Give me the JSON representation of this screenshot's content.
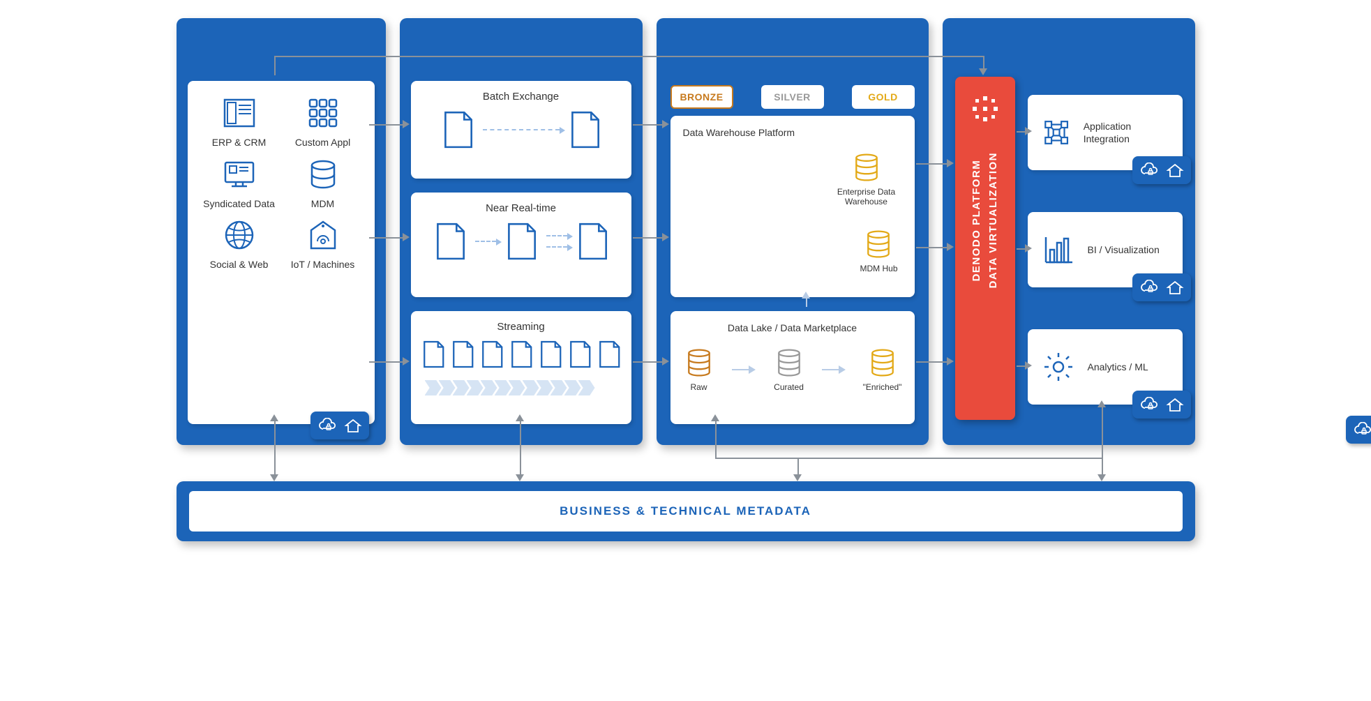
{
  "sources": {
    "items": [
      {
        "label": "ERP & CRM",
        "icon": "erp"
      },
      {
        "label": "Custom Appl",
        "icon": "grid"
      },
      {
        "label": "Syndicated Data",
        "icon": "monitor"
      },
      {
        "label": "MDM",
        "icon": "db"
      },
      {
        "label": "Social & Web",
        "icon": "globe"
      },
      {
        "label": "IoT / Machines",
        "icon": "iot"
      }
    ]
  },
  "processing": {
    "batch": "Batch Exchange",
    "nrt": "Near Real-time",
    "stream": "Streaming"
  },
  "tiers": {
    "bronze": "BRONZE",
    "silver": "SILVER",
    "gold": "GOLD"
  },
  "warehouse": {
    "title": "Data Warehouse Platform",
    "edw": "Enterprise Data Warehouse",
    "mdm": "MDM Hub"
  },
  "lake": {
    "title": "Data Lake / Data Marketplace",
    "raw": "Raw",
    "curated": "Curated",
    "enriched": "\"Enriched\""
  },
  "denodo": {
    "line1": "DENODO PLATFORM",
    "line2": "DATA VIRTUALIZATION"
  },
  "consumers": {
    "app": "Application Integration",
    "bi": "BI / Visualization",
    "ml": "Analytics / ML"
  },
  "footer": "BUSINESS & TECHNICAL METADATA"
}
